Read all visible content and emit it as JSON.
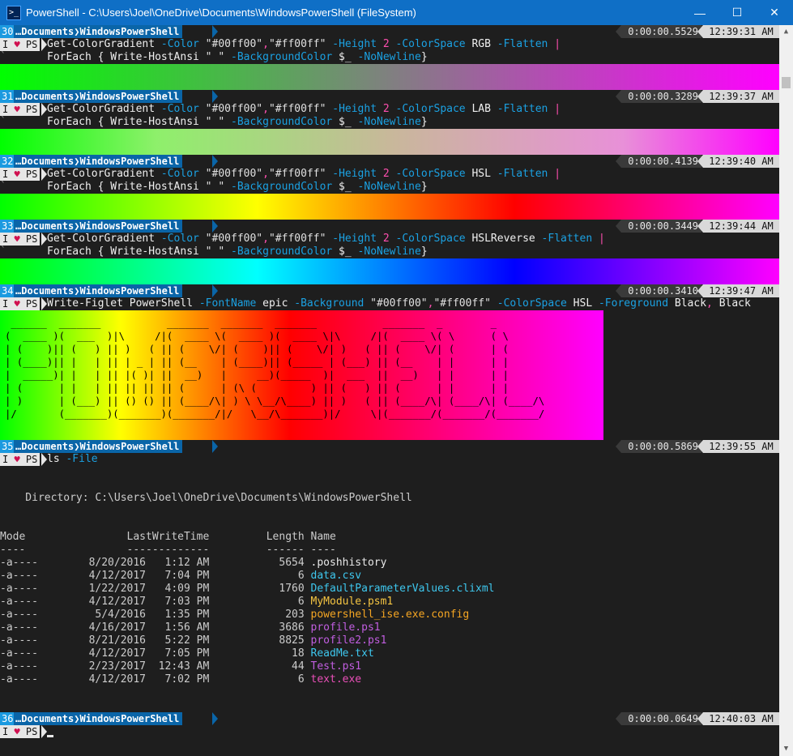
{
  "window": {
    "title": "PowerShell - C:\\Users\\Joel\\OneDrive\\Documents\\WindowsPowerShell (FileSystem)",
    "icon": "powershell-icon",
    "controls": [
      "minimize-icon",
      "maximize-icon",
      "close-icon"
    ]
  },
  "prompt": {
    "path_ellipsis": "…",
    "path_parts": [
      "Documents",
      "WindowsPowerShell"
    ],
    "badge_text": "I",
    "badge_heart": "♥",
    "badge_ps": "PS"
  },
  "blocks": [
    {
      "num": "30",
      "duration": "0:00:00.5529",
      "time": "12:39:31 AM",
      "line1": [
        {
          "t": "Get-ColorGradient",
          "c": "cmd"
        },
        {
          "t": " ",
          "c": "cmd"
        },
        {
          "t": "-Color",
          "c": "par"
        },
        {
          "t": " \"#00ff00\"",
          "c": "str"
        },
        {
          "t": ",",
          "c": "op"
        },
        {
          "t": "\"#ff00ff\"",
          "c": "str"
        },
        {
          "t": " -Height",
          "c": "par"
        },
        {
          "t": " 2",
          "c": "num"
        },
        {
          "t": " -ColorSpace",
          "c": "par"
        },
        {
          "t": " RGB",
          "c": "arg"
        },
        {
          "t": " -Flatten",
          "c": "par"
        },
        {
          "t": " |",
          "c": "op"
        }
      ],
      "line2": [
        {
          "t": "ForEach",
          "c": "cmd"
        },
        {
          "t": " { ",
          "c": "cmd"
        },
        {
          "t": "Write-HostAnsi",
          "c": "cmd"
        },
        {
          "t": " \" \"",
          "c": "str"
        },
        {
          "t": " -BackgroundColor",
          "c": "par"
        },
        {
          "t": " $_",
          "c": "var"
        },
        {
          "t": " -NoNewline",
          "c": "par"
        },
        {
          "t": "}",
          "c": "cmd"
        }
      ],
      "gradient_space": "RGB"
    },
    {
      "num": "31",
      "duration": "0:00:00.3289",
      "time": "12:39:37 AM",
      "line1": [
        {
          "t": "Get-ColorGradient",
          "c": "cmd"
        },
        {
          "t": " ",
          "c": "cmd"
        },
        {
          "t": "-Color",
          "c": "par"
        },
        {
          "t": " \"#00ff00\"",
          "c": "str"
        },
        {
          "t": ",",
          "c": "op"
        },
        {
          "t": "\"#ff00ff\"",
          "c": "str"
        },
        {
          "t": " -Height",
          "c": "par"
        },
        {
          "t": " 2",
          "c": "num"
        },
        {
          "t": " -ColorSpace",
          "c": "par"
        },
        {
          "t": " LAB",
          "c": "arg"
        },
        {
          "t": " -Flatten",
          "c": "par"
        },
        {
          "t": " |",
          "c": "op"
        }
      ],
      "line2": [
        {
          "t": "ForEach",
          "c": "cmd"
        },
        {
          "t": " { ",
          "c": "cmd"
        },
        {
          "t": "Write-HostAnsi",
          "c": "cmd"
        },
        {
          "t": " \" \"",
          "c": "str"
        },
        {
          "t": " -BackgroundColor",
          "c": "par"
        },
        {
          "t": " $_",
          "c": "var"
        },
        {
          "t": " -NoNewline",
          "c": "par"
        },
        {
          "t": "}",
          "c": "cmd"
        }
      ],
      "gradient_space": "LAB"
    },
    {
      "num": "32",
      "duration": "0:00:00.4139",
      "time": "12:39:40 AM",
      "line1": [
        {
          "t": "Get-ColorGradient",
          "c": "cmd"
        },
        {
          "t": " ",
          "c": "cmd"
        },
        {
          "t": "-Color",
          "c": "par"
        },
        {
          "t": " \"#00ff00\"",
          "c": "str"
        },
        {
          "t": ",",
          "c": "op"
        },
        {
          "t": "\"#ff00ff\"",
          "c": "str"
        },
        {
          "t": " -Height",
          "c": "par"
        },
        {
          "t": " 2",
          "c": "num"
        },
        {
          "t": " -ColorSpace",
          "c": "par"
        },
        {
          "t": " HSL",
          "c": "arg"
        },
        {
          "t": " -Flatten",
          "c": "par"
        },
        {
          "t": " |",
          "c": "op"
        }
      ],
      "line2": [
        {
          "t": "ForEach",
          "c": "cmd"
        },
        {
          "t": " { ",
          "c": "cmd"
        },
        {
          "t": "Write-HostAnsi",
          "c": "cmd"
        },
        {
          "t": " \" \"",
          "c": "str"
        },
        {
          "t": " -BackgroundColor",
          "c": "par"
        },
        {
          "t": " $_",
          "c": "var"
        },
        {
          "t": " -NoNewline",
          "c": "par"
        },
        {
          "t": "}",
          "c": "cmd"
        }
      ],
      "gradient_space": "HSL"
    },
    {
      "num": "33",
      "duration": "0:00:00.3449",
      "time": "12:39:44 AM",
      "line1": [
        {
          "t": "Get-ColorGradient",
          "c": "cmd"
        },
        {
          "t": " ",
          "c": "cmd"
        },
        {
          "t": "-Color",
          "c": "par"
        },
        {
          "t": " \"#00ff00\"",
          "c": "str"
        },
        {
          "t": ",",
          "c": "op"
        },
        {
          "t": "\"#ff00ff\"",
          "c": "str"
        },
        {
          "t": " -Height",
          "c": "par"
        },
        {
          "t": " 2",
          "c": "num"
        },
        {
          "t": " -ColorSpace",
          "c": "par"
        },
        {
          "t": " HSLReverse",
          "c": "arg"
        },
        {
          "t": " -Flatten",
          "c": "par"
        },
        {
          "t": " |",
          "c": "op"
        }
      ],
      "line2": [
        {
          "t": "ForEach",
          "c": "cmd"
        },
        {
          "t": " { ",
          "c": "cmd"
        },
        {
          "t": "Write-HostAnsi",
          "c": "cmd"
        },
        {
          "t": " \" \"",
          "c": "str"
        },
        {
          "t": " -BackgroundColor",
          "c": "par"
        },
        {
          "t": " $_",
          "c": "var"
        },
        {
          "t": " -NoNewline",
          "c": "par"
        },
        {
          "t": "}",
          "c": "cmd"
        }
      ],
      "gradient_space": "HSLReverse"
    }
  ],
  "figlet_block": {
    "num": "34",
    "duration": "0:00:00.3410",
    "time": "12:39:47 AM",
    "line1": [
      {
        "t": "Write-Figlet",
        "c": "cmd"
      },
      {
        "t": " PowerShell",
        "c": "arg"
      },
      {
        "t": " -FontName",
        "c": "par"
      },
      {
        "t": " epic",
        "c": "arg"
      },
      {
        "t": " -Background",
        "c": "par"
      },
      {
        "t": " \"#00ff00\"",
        "c": "str"
      },
      {
        "t": ",",
        "c": "op"
      },
      {
        "t": "\"#ff00ff\"",
        "c": "str"
      },
      {
        "t": " -ColorSpace",
        "c": "par"
      },
      {
        "t": " HSL",
        "c": "arg"
      },
      {
        "t": " -Foreground",
        "c": "par"
      },
      {
        "t": " Black",
        "c": "arg"
      },
      {
        "t": ",",
        "c": "op"
      },
      {
        "t": " Black",
        "c": "arg"
      }
    ],
    "art": " ______  _______           _______  _______  _______           _______  _        _       \n(  ____ )(  ___  )|\\     /|(  ____ \\(  ____ )(  ____ \\|\\     /|(  ____ \\( \\      ( \\      \n| (    )|| (   ) || )   ( || (    \\/| (    )|| (    \\/| )   ( || (    \\/| (      | (      \n| (____)|| |   | || | _ | || (__    | (____)|| (_____ | (___) || (__    | |      | |      \n|  _____)| |   | || |( )| ||  __)   |     __)(_____  )|  ___  ||  __)   | |      | |      \n| (      | |   | || || || || (      | (\\ (         ) || (   ) || (      | |      | |      \n| )      | (___) || () () || (____/\\| ) \\ \\__/\\____) || )   ( || (____/\\| (____/\\| (____/\\\n|/       (_______)(_______)(_______/|/   \\__/\\_______)|/     \\|(_______/(_______/(_______/"
  },
  "ls_block": {
    "num": "35",
    "duration": "0:00:00.5869",
    "time": "12:39:55 AM",
    "command": [
      {
        "t": "ls",
        "c": "cmd"
      },
      {
        "t": " -File",
        "c": "par"
      }
    ],
    "directory_label": "    Directory: C:\\Users\\Joel\\OneDrive\\Documents\\WindowsPowerShell",
    "header": "Mode                LastWriteTime         Length Name",
    "header_rule": "----                -------------         ------ ----",
    "rows": [
      {
        "prefix": "-a----        8/20/2016   1:12 AM           5654 ",
        "name": ".poshhistory",
        "kind": "default"
      },
      {
        "prefix": "-a----        4/12/2017   7:04 PM              6 ",
        "name": "data.csv",
        "kind": "csv"
      },
      {
        "prefix": "-a----        1/22/2017   4:09 PM           1760 ",
        "name": "DefaultParameterValues.clixml",
        "kind": "xml"
      },
      {
        "prefix": "-a----        4/12/2017   7:03 PM              6 ",
        "name": "MyModule.psm1",
        "kind": "psm1"
      },
      {
        "prefix": "-a----         5/4/2016   1:35 PM            203 ",
        "name": "powershell_ise.exe.config",
        "kind": "config"
      },
      {
        "prefix": "-a----        4/16/2017   1:56 AM           3686 ",
        "name": "profile.ps1",
        "kind": "ps1"
      },
      {
        "prefix": "-a----        8/21/2016   5:22 PM           8825 ",
        "name": "profile2.ps1",
        "kind": "ps1"
      },
      {
        "prefix": "-a----        4/12/2017   7:05 PM             18 ",
        "name": "ReadMe.txt",
        "kind": "txt"
      },
      {
        "prefix": "-a----        2/23/2017  12:43 AM             44 ",
        "name": "Test.ps1",
        "kind": "ps1"
      },
      {
        "prefix": "-a----        4/12/2017   7:02 PM              6 ",
        "name": "text.exe",
        "kind": "exe"
      }
    ]
  },
  "last_block": {
    "num": "36",
    "duration": "0:00:00.0649",
    "time": "12:40:03 AM"
  }
}
